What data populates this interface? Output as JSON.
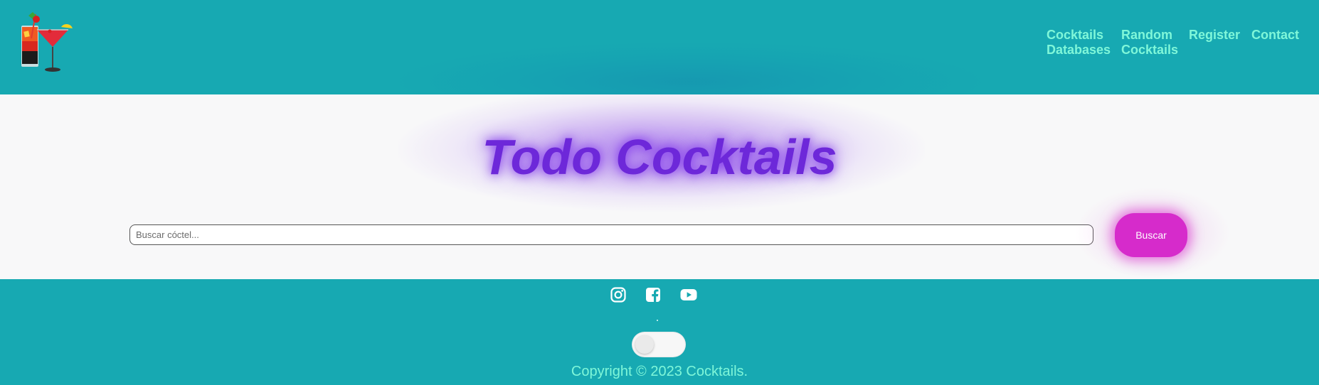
{
  "header": {
    "logo_alt": "cocktail glasses logo",
    "nav": [
      {
        "line1": "Cocktails",
        "line2": "Databases"
      },
      {
        "line1": "Random",
        "line2": "Cocktails"
      },
      {
        "line1": "Register",
        "line2": ""
      },
      {
        "line1": "Contact",
        "line2": ""
      }
    ]
  },
  "main": {
    "title": "Todo Cocktails",
    "search": {
      "placeholder": "Buscar cóctel...",
      "value": "",
      "button_label": "Buscar"
    }
  },
  "footer": {
    "social_icons": [
      "instagram-icon",
      "facebook-icon",
      "youtube-icon"
    ],
    "dot": ".",
    "theme_toggle_on": false,
    "copyright": "Copyright © 2023 Cocktails."
  },
  "colors": {
    "teal_background": "#17a9b2",
    "nav_text": "#7ff7d9",
    "title_purple": "#6d28d9",
    "button_magenta": "#d62bcb",
    "main_background": "#f8f8f9"
  }
}
